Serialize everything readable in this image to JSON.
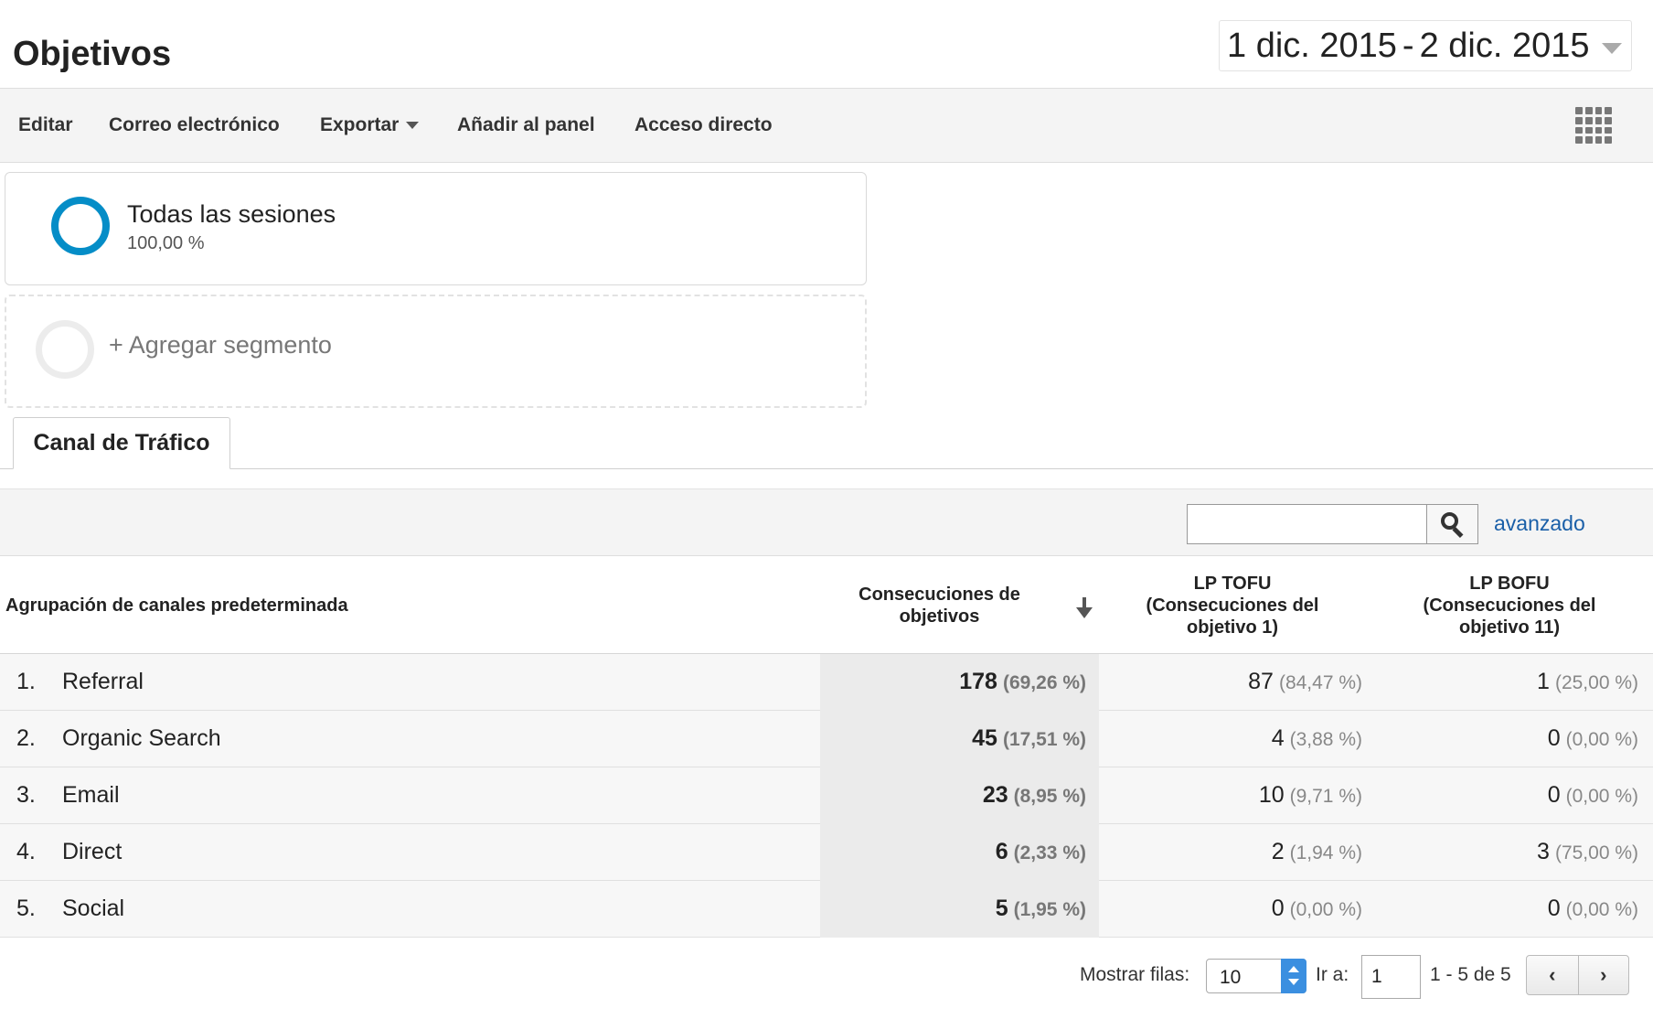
{
  "page": {
    "title": "Objetivos",
    "date_range": {
      "start": "1 dic. 2015",
      "separator": "-",
      "end": "2 dic. 2015"
    }
  },
  "toolbar": {
    "edit": "Editar",
    "email": "Correo electrónico",
    "export": "Exportar",
    "add_to_panel": "Añadir al panel",
    "shortcut": "Acceso directo",
    "grid_icon": "grid-icon"
  },
  "segments": {
    "active": {
      "name": "Todas las sesiones",
      "percent": "100,00 %",
      "color": "#058dc7"
    },
    "add": {
      "label": "+ Agregar segmento"
    }
  },
  "tabs": [
    {
      "label": "Canal de Tráfico",
      "active": true
    }
  ],
  "filter": {
    "search_value": "",
    "advanced": "avanzado",
    "search_icon": "search-icon"
  },
  "table": {
    "headers": {
      "dimension": "Agrupación de canales predeterminada",
      "col1": "Consecuciones de objetivos",
      "col2": "LP TOFU (Consecuciones del objetivo 1)",
      "col3": "LP BOFU (Consecuciones del objetivo 11)"
    },
    "rows": [
      {
        "num": "1.",
        "label": "Referral",
        "c1": "178",
        "c1p": "(69,26 %)",
        "c2": "87",
        "c2p": "(84,47 %)",
        "c3": "1",
        "c3p": "(25,00 %)"
      },
      {
        "num": "2.",
        "label": "Organic Search",
        "c1": "45",
        "c1p": "(17,51 %)",
        "c2": "4",
        "c2p": "(3,88 %)",
        "c3": "0",
        "c3p": "(0,00 %)"
      },
      {
        "num": "3.",
        "label": "Email",
        "c1": "23",
        "c1p": "(8,95 %)",
        "c2": "10",
        "c2p": "(9,71 %)",
        "c3": "0",
        "c3p": "(0,00 %)"
      },
      {
        "num": "4.",
        "label": "Direct",
        "c1": "6",
        "c1p": "(2,33 %)",
        "c2": "2",
        "c2p": "(1,94 %)",
        "c3": "3",
        "c3p": "(75,00 %)"
      },
      {
        "num": "5.",
        "label": "Social",
        "c1": "5",
        "c1p": "(1,95 %)",
        "c2": "0",
        "c2p": "(0,00 %)",
        "c3": "0",
        "c3p": "(0,00 %)"
      }
    ]
  },
  "pagination": {
    "show_rows_label": "Mostrar filas:",
    "rows_value": "10",
    "goto_label": "Ir a:",
    "goto_value": "1",
    "range": "1 - 5 de 5",
    "prev": "‹",
    "next": "›"
  }
}
